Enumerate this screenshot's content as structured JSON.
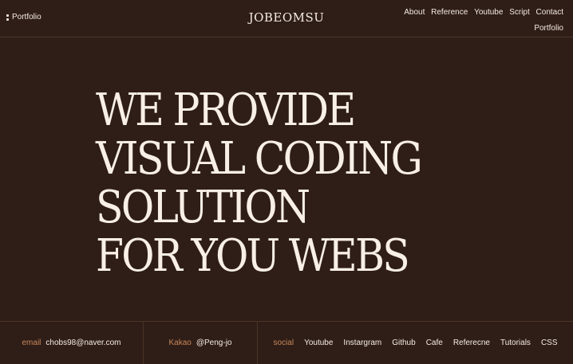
{
  "header": {
    "portfolio_label": "Portfolio",
    "logo": "JOBEOMSU",
    "nav": [
      "About",
      "Reference",
      "Youtube",
      "Script",
      "Contact",
      "Portfolio"
    ]
  },
  "hero": {
    "lines": [
      "WE PROVIDE",
      "VISUAL CODING",
      "SOLUTION",
      "FOR YOU WEBS"
    ]
  },
  "footer": {
    "email_label": "email",
    "email_value": "chobs98@naver.com",
    "kakao_label": "Kakao",
    "kakao_value": "@Peng-jo",
    "social_label": "social",
    "social_links": [
      "Youtube",
      "Instargram",
      "Github",
      "Cafe",
      "Referecne",
      "Tutorials",
      "CSS"
    ]
  },
  "colors": {
    "background": "#2f1e17",
    "text": "#f4ebe2",
    "accent": "#c8875a"
  }
}
